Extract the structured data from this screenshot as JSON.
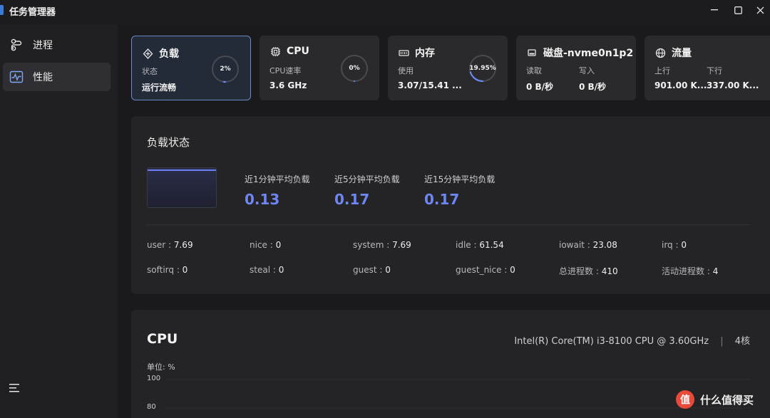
{
  "window": {
    "title": "任务管理器"
  },
  "sidebar": {
    "items": [
      {
        "label": "进程",
        "icon": "process-icon",
        "active": false
      },
      {
        "label": "性能",
        "icon": "performance-icon",
        "active": true
      }
    ],
    "menu_icon": "menu-icon"
  },
  "cards": {
    "load": {
      "title": "负载",
      "sub": "状态",
      "value": "运行流畅",
      "gauge_text": "2%",
      "gauge_fraction": 0.02
    },
    "cpu": {
      "title": "CPU",
      "sub": "CPU速率",
      "value": "3.6 GHz",
      "gauge_text": "0%",
      "gauge_fraction": 0.0
    },
    "memory": {
      "title": "内存",
      "sub": "使用",
      "value": "3.07/15.41 ...",
      "gauge_text": "19.95%",
      "gauge_fraction": 0.1995
    },
    "disk": {
      "title": "磁盘-nvme0n1p2",
      "read_label": "读取",
      "write_label": "写入",
      "read_value": "0 B/秒",
      "write_value": "0 B/秒"
    },
    "network": {
      "title": "流量",
      "up_label": "上行",
      "down_label": "下行",
      "up_value": "901.00 K...",
      "down_value": "337.00 K..."
    }
  },
  "load_panel": {
    "title": "负载状态",
    "averages": [
      {
        "label": "近1分钟平均负载",
        "value": "0.13"
      },
      {
        "label": "近5分钟平均负载",
        "value": "0.17"
      },
      {
        "label": "近15分钟平均负载",
        "value": "0.17"
      }
    ],
    "stats_row1": [
      {
        "key": "user",
        "value": "7.69"
      },
      {
        "key": "nice",
        "value": "0"
      },
      {
        "key": "system",
        "value": "7.69"
      },
      {
        "key": "idle",
        "value": "61.54"
      },
      {
        "key": "iowait",
        "value": "23.08"
      },
      {
        "key": "irq",
        "value": "0"
      }
    ],
    "stats_row2": [
      {
        "key": "softirq",
        "value": "0"
      },
      {
        "key": "steal",
        "value": "0"
      },
      {
        "key": "guest",
        "value": "0"
      },
      {
        "key": "guest_nice",
        "value": "0"
      },
      {
        "key": "总进程数",
        "value": "410"
      },
      {
        "key": "活动进程数",
        "value": "4"
      }
    ],
    "separator": " : "
  },
  "cpu_panel": {
    "title": "CPU",
    "model": "Intel(R) Core(TM) i3-8100 CPU @ 3.60GHz",
    "divider": "|",
    "cores": "4核",
    "unit": "单位: %",
    "yticks": [
      "100",
      "80"
    ]
  },
  "watermark": {
    "logo": "值",
    "text": "什么值得买"
  },
  "colors": {
    "accent": "#6e86f2",
    "selected_border": "#6e8ac8",
    "gauge_track": "#4a4a50",
    "gauge_fill": "#6e86f2"
  }
}
